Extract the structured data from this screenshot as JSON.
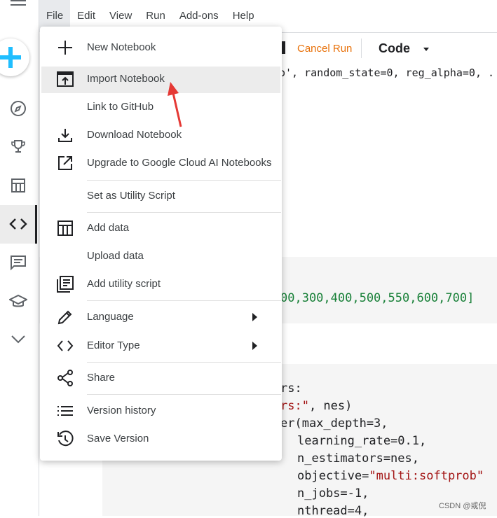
{
  "menubar": {
    "items": [
      "File",
      "Edit",
      "View",
      "Run",
      "Add-ons",
      "Help"
    ],
    "selected": "File"
  },
  "toolbar": {
    "cancel_label": "Cancel Run",
    "cell_type_label": "Code"
  },
  "file_menu": {
    "items": [
      {
        "label": "New Notebook",
        "icon": "plus-icon"
      },
      {
        "label": "Import Notebook",
        "icon": "import-icon",
        "highlighted": true
      },
      {
        "label": "Link to GitHub",
        "icon": ""
      },
      {
        "label": "Download Notebook",
        "icon": "download-icon"
      },
      {
        "label": "Upgrade to Google Cloud AI Notebooks",
        "icon": "external-link-icon"
      },
      {
        "label": "Set as Utility Script",
        "icon": ""
      },
      {
        "label": "Add data",
        "icon": "table-icon"
      },
      {
        "label": "Upload data",
        "icon": ""
      },
      {
        "label": "Add utility script",
        "icon": "script-icon"
      },
      {
        "label": "Language",
        "icon": "pencil-icon",
        "submenu": true
      },
      {
        "label": "Editor Type",
        "icon": "code-icon",
        "submenu": true
      },
      {
        "label": "Share",
        "icon": "share-icon"
      },
      {
        "label": "Version history",
        "icon": "list-icon"
      },
      {
        "label": "Save Version",
        "icon": "history-icon"
      }
    ]
  },
  "code": {
    "line1": "o', random_state=0, reg_alpha=0, .",
    "line2": "00,300,400,500,550,600,700]",
    "line3": "rs:",
    "line4a": "rs:\"",
    "line4b": ", nes)",
    "line5": "er(max_depth=3,",
    "line6": "learning_rate=0.1,",
    "line7": "n_estimators=nes,",
    "line8a": "objective=",
    "line8b": "\"multi:softprob\"",
    "line9": "n_jobs=-1,",
    "line10": "nthread=4,"
  },
  "watermark": "CSDN @或倪",
  "colors": {
    "accent_blue": "#1a73e8",
    "cancel_orange": "#e8710a",
    "arrow_red": "#e53935"
  }
}
